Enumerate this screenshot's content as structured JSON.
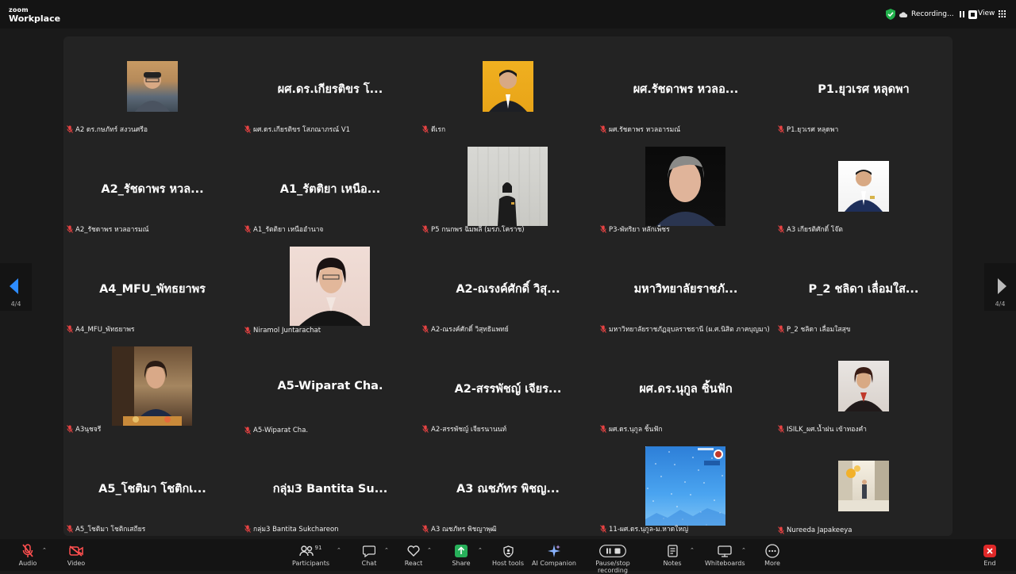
{
  "app": {
    "logo_top": "zoom",
    "logo_bottom": "Workplace",
    "recording": "Recording...",
    "view": "View"
  },
  "tiles": [
    {
      "label": "A2 ดร.กษภัทร์ สงวนศรีอ",
      "name": ""
    },
    {
      "label": "ผศ.ดร.เกียรติขร โสภณาภรณ์ V1",
      "name": "ผศ.ดร.เกียรติขร โ..."
    },
    {
      "label": "ดีเรก",
      "name": ""
    },
    {
      "label": "ผศ.รัชดาพร หวลอารมณ์",
      "name": "ผศ.รัชดาพร หวลอ..."
    },
    {
      "label": "P1.ยุวเรศ หลุดพา",
      "name": "P1.ยุวเรศ หลุดพา"
    },
    {
      "label": "A2_รัชดาพร หวลอารมณ์",
      "name": "A2_รัชดาพร หวล..."
    },
    {
      "label": "A1_รัตติยา เหนืออำนาจ",
      "name": "A1_รัตติยา เหนือ..."
    },
    {
      "label": "P5 กนกพร ฉิมพลี (มรภ.โคราช)",
      "name": ""
    },
    {
      "label": "P3-พัทริยา หลักเพ็ชร",
      "name": ""
    },
    {
      "label": "A3 เกียรติศักดิ์ โจ๊ต",
      "name": ""
    },
    {
      "label": "A4_MFU_พัทธยาพร",
      "name": "A4_MFU_พัทธยาพร"
    },
    {
      "label": "Niramol Juntarachat",
      "name": ""
    },
    {
      "label": "A2-ณรงค์ศักดิ์ วิสุทธิแพทย์",
      "name": "A2-ณรงค์ศักดิ์ วิสุ..."
    },
    {
      "label": "มหาวิทยาลัยราชภัฏอุบลราชธานี (ผ.ศ.นิสิต ภาคบุญมา)",
      "name": "มหาวิทยาลัยราชภั..."
    },
    {
      "label": "P_2 ชลิดา เลื่อมใสสุข",
      "name": "P_2 ชลิดา เลื่อมใส..."
    },
    {
      "label": "A3นุชจรี",
      "name": ""
    },
    {
      "label": "A5-Wiparat Cha.",
      "name": "A5-Wiparat Cha."
    },
    {
      "label": "A2-สรรพัชญ์ เจียรนานนท์",
      "name": "A2-สรรพัชญ์ เจียร..."
    },
    {
      "label": "ผศ.ดร.นุกูล ชิ้นฟัก",
      "name": "ผศ.ดร.นุกูล ชิ้นฟัก"
    },
    {
      "label": "ISILK_ผศ.น้ำฝน เข้าทองคำ",
      "name": ""
    },
    {
      "label": "A5_โชติมา โชติกเสถียร",
      "name": "A5_โชติมา โชติกเ..."
    },
    {
      "label": "กลุ่ม3 Bantita Sukchareon",
      "name": "กลุ่ม3 Bantita Su..."
    },
    {
      "label": "A3 ณชภัทร พิชญาพุฒิ",
      "name": "A3 ณชภัทร พิชญ..."
    },
    {
      "label": "11-ผศ.ดร.นุกูล-ม.หาดใหญ่",
      "name": ""
    },
    {
      "label": "Nureeda Japakeeya",
      "name": ""
    }
  ],
  "nav": {
    "page": "4/4"
  },
  "toolbar": {
    "audio": "Audio",
    "video": "Video",
    "participants": "Participants",
    "participants_count": "91",
    "chat": "Chat",
    "react": "React",
    "share": "Share",
    "host_tools": "Host tools",
    "ai": "AI Companion",
    "pause": "Pause/stop recording",
    "notes": "Notes",
    "whiteboards": "Whiteboards",
    "more": "More",
    "end": "End"
  }
}
